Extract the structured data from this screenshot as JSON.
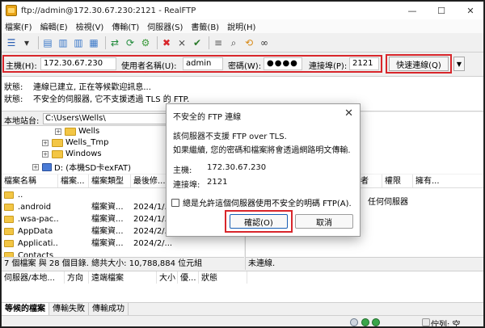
{
  "window": {
    "title": "ftp://admin@172.30.67.230:2121 - RealFTP",
    "controls": [
      "—",
      "☐",
      "✕"
    ]
  },
  "menu": [
    "檔案(F)",
    "編輯(E)",
    "檢視(V)",
    "傳輸(T)",
    "伺服器(S)",
    "書籤(B)",
    "說明(H)"
  ],
  "toolbar": {
    "icons": [
      {
        "name": "site-manager-icon",
        "glyph": "☰",
        "color": "#2b5fb3"
      },
      {
        "name": "dropdown-arrow-icon",
        "glyph": "▾",
        "color": "#333333"
      },
      {
        "name": "toggle-log-icon",
        "glyph": "▤",
        "color": "#3a78c9"
      },
      {
        "name": "toggle-tree-icon",
        "glyph": "▥",
        "color": "#3a78c9"
      },
      {
        "name": "toggle-remote-tree-icon",
        "glyph": "▥",
        "color": "#3a78c9"
      },
      {
        "name": "toggle-queue-icon",
        "glyph": "▦",
        "color": "#3a78c9"
      },
      {
        "name": "transfer-icon",
        "glyph": "⇄",
        "color": "#1f8a3a"
      },
      {
        "name": "refresh-icon",
        "glyph": "⟳",
        "color": "#1f8a3a"
      },
      {
        "name": "process-queue-icon",
        "glyph": "⚙",
        "color": "#3b9a3b"
      },
      {
        "name": "cancel-icon",
        "glyph": "✖",
        "color": "#d8262b"
      },
      {
        "name": "disconnect-icon",
        "glyph": "⨯",
        "color": "#444444"
      },
      {
        "name": "reconnect-icon",
        "glyph": "✔",
        "color": "#2b7a2b"
      },
      {
        "name": "filter-icon",
        "glyph": "≡",
        "color": "#555555"
      },
      {
        "name": "search-icon",
        "glyph": "⌕",
        "color": "#444444"
      },
      {
        "name": "compare-icon",
        "glyph": "⟲",
        "color": "#d88a17"
      },
      {
        "name": "binoculars-icon",
        "glyph": "∞",
        "color": "#333333"
      }
    ]
  },
  "connection": {
    "host_label": "主機(H):",
    "host_value": "172.30.67.230",
    "user_label": "使用者名稱(U):",
    "user_value": "admin",
    "password_label": "密碼(W):",
    "password_value": "●●●●",
    "port_label": "連接埠(P):",
    "port_value": "2121",
    "quickconnect_label": "快速連線(Q)",
    "quickconnect_dropdown": "▼"
  },
  "log": [
    {
      "key": "狀態:",
      "text": "連線已建立, 正在等候歡迎訊息..."
    },
    {
      "key": "狀態:",
      "text": "不安全的伺服器, 它不支援透過 TLS 的 FTP."
    }
  ],
  "local": {
    "path_label": "本地站台:",
    "path_value": "C:\\Users\\Wells\\",
    "tree": [
      {
        "label": "Wells",
        "expander": "+",
        "type": "folder"
      },
      {
        "label": "Wells_Tmp",
        "expander": "+",
        "type": "folder"
      },
      {
        "label": "Windows",
        "expander": "+",
        "type": "folder"
      },
      {
        "label": "D: (本機SD卡exFAT)",
        "expander": "+",
        "type": "drive"
      }
    ],
    "columns": [
      "檔案名稱",
      "檔案...",
      "檔案類型",
      "最後修..."
    ],
    "files": [
      {
        "name": "..",
        "size": "",
        "type": "",
        "modified": ""
      },
      {
        "name": ".android",
        "size": "",
        "type": "檔案資...",
        "modified": "2024/1/..."
      },
      {
        "name": ".wsa-pac...",
        "size": "",
        "type": "檔案資...",
        "modified": "2024/1/..."
      },
      {
        "name": "AppData",
        "size": "",
        "type": "檔案資...",
        "modified": "2024/2/..."
      },
      {
        "name": "Applicati...",
        "size": "",
        "type": "檔案資...",
        "modified": "2024/2/..."
      },
      {
        "name": "Contacts",
        "size": "",
        "type": "",
        "modified": ""
      }
    ],
    "status": "7 個檔案 與 28 個目錄. 總共大小: 10,788,884 位元組"
  },
  "remote": {
    "columns": [
      "權限",
      "擁有..."
    ],
    "column_prefix": "者",
    "placeholder": "任何伺服器",
    "status": "未連線."
  },
  "queue": {
    "columns": [
      "伺服器/本地...",
      "方向",
      "遠端檔案",
      "大小",
      "優...",
      "狀態"
    ],
    "tabs": [
      "等候的檔案",
      "傳輸失敗",
      "傳輸成功"
    ],
    "status_text": "佇列: 空"
  },
  "dialog": {
    "title": "不安全的 FTP 連線",
    "close": "✕",
    "line1": "該伺服器不支援 FTP over TLS.",
    "line2": "如果繼續, 您的密碼和檔案將會透過網路明文傳輸.",
    "host_label": "主機:",
    "host_value": "172.30.67.230",
    "port_label": "連接埠:",
    "port_value": "2121",
    "checkbox_label": "總是允許這個伺服器使用不安全的明碼 FTP(A).",
    "ok_label": "確認(O)",
    "cancel_label": "取消"
  },
  "colors": {
    "highlight": "#d8262b",
    "folder": "#f3c645",
    "primary_border": "#1a5fb4"
  }
}
